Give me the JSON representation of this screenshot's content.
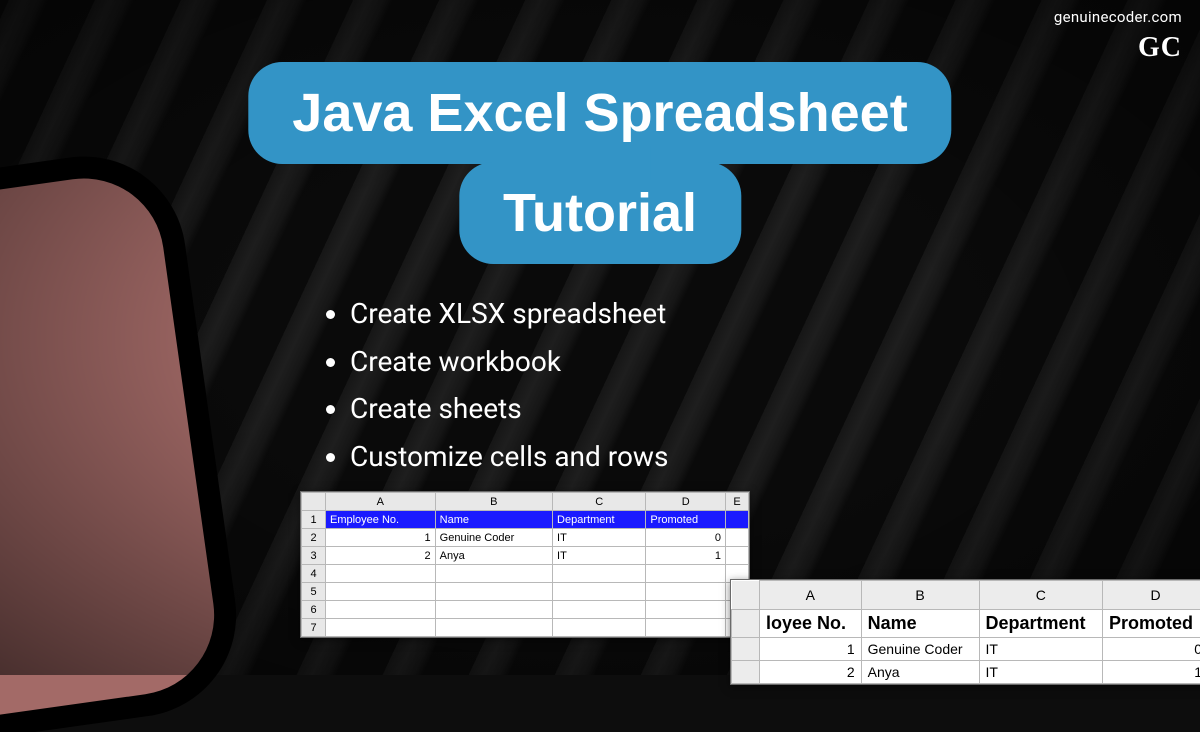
{
  "brand": {
    "url": "genuinecoder.com",
    "logo": "GC"
  },
  "title": {
    "line1": "Java Excel Spreadsheet",
    "line2": "Tutorial"
  },
  "bullets": [
    "Create XLSX spreadsheet",
    "Create workbook",
    "Create sheets",
    "Customize cells and rows"
  ],
  "sheet_small": {
    "columns": [
      "A",
      "B",
      "C",
      "D",
      "E"
    ],
    "headers": [
      "Employee No.",
      "Name",
      "Department",
      "Promoted"
    ],
    "rows": [
      {
        "n": "1",
        "no": "1",
        "name": "Genuine Coder",
        "dept": "IT",
        "prom": "0"
      },
      {
        "n": "2",
        "no": "2",
        "name": "Anya",
        "dept": "IT",
        "prom": "1"
      }
    ],
    "blank_rows": [
      "4",
      "5",
      "6",
      "7"
    ]
  },
  "sheet_large": {
    "columns": [
      "A",
      "B",
      "C",
      "D"
    ],
    "headers": [
      "loyee No.",
      "Name",
      "Department",
      "Promoted"
    ],
    "rows": [
      {
        "no": "1",
        "name": "Genuine Coder",
        "dept": "IT",
        "prom": "0"
      },
      {
        "no": "2",
        "name": "Anya",
        "dept": "IT",
        "prom": "1"
      }
    ]
  }
}
